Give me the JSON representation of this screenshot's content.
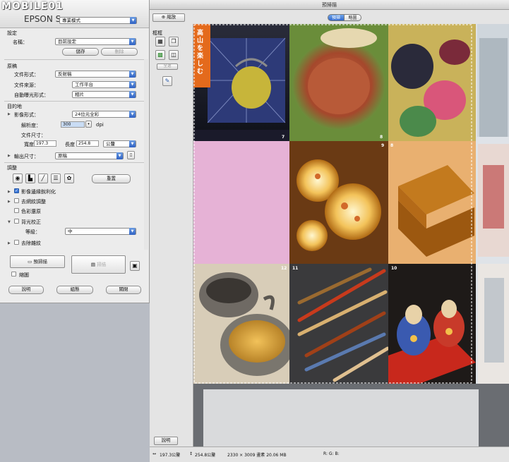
{
  "scan_panel": {
    "watermark": "MOBILE01",
    "app_title": "EPSON Scan",
    "mode_select": "專業模式",
    "settings": {
      "section": "設定",
      "name_label": "名稱：",
      "name_value": "目前設定",
      "save_button": "儲存",
      "delete_button": "刪除"
    },
    "source": {
      "section": "原稿",
      "doc_type_label": "文件形式：",
      "doc_type_value": "反射稿",
      "doc_source_label": "文件來源：",
      "doc_source_value": "工作平台",
      "auto_exposure_label": "自動曝光形式：",
      "auto_exposure_value": "相片"
    },
    "destination": {
      "section": "目的地",
      "image_type_label": "影像形式：",
      "image_type_value": "24位元全彩",
      "resolution_label": "解析度：",
      "resolution_value": "300",
      "resolution_unit": "dpi",
      "doc_size_label": "文件尺寸：",
      "width_label": "寬度",
      "width_value": "197.3",
      "height_label": "長度",
      "height_value": "254.8",
      "unit_value": "公釐",
      "output_size_label": "輸出尺寸：",
      "output_size_value": "原稿"
    },
    "adjustments": {
      "section": "調整",
      "reset_button": "重置",
      "unsharp_label": "影像邊緣銳利化",
      "descreen_label": "去網紋調整",
      "color_restore_label": "色彩還原",
      "backlight_label": "背光校正",
      "level_label": "等級：",
      "level_value": "中",
      "dust_label": "去除雜紋"
    },
    "preview_button": "預掃描",
    "scan_button": "掃描",
    "thumbnail_label": "縮圖",
    "help_button": "說明",
    "config_button": "組態",
    "close_button": "關閉"
  },
  "preview_window": {
    "title": "預掃描",
    "tab_preview": "預掃",
    "tab_other": "略圖",
    "zoom_button": "縮放",
    "frame_label": "框框",
    "select_all": "全選",
    "help_button": "說明",
    "status": {
      "width": "197.3公釐",
      "height": "254.8公釐",
      "pixels": "2330 × 3009 畫素 20.06 MB",
      "rgb": "R: G: B:"
    },
    "magazine": {
      "banner": "高山を楽しむ",
      "page_numbers": [
        "7",
        "8",
        "9",
        "8",
        "12",
        "11",
        "10"
      ]
    }
  },
  "colors": {
    "accent": "#3b78d8",
    "banner": "#e46a1c",
    "pink_page": "#d98fbf"
  }
}
